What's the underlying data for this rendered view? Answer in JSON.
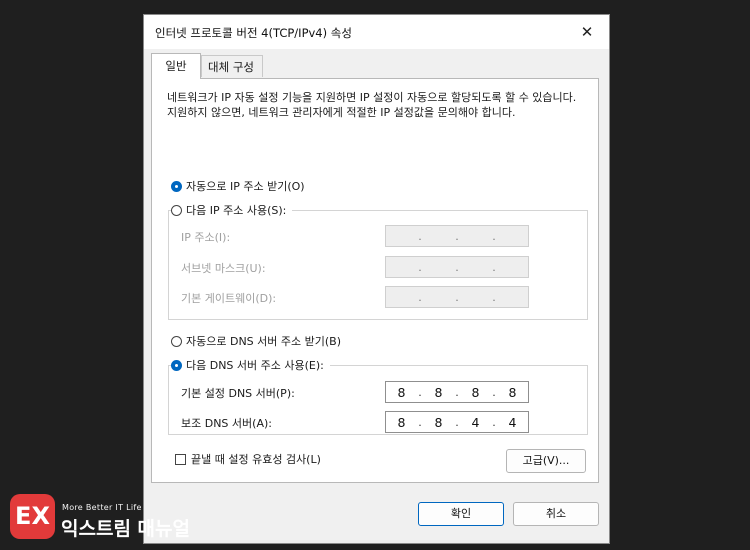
{
  "window": {
    "title": "인터넷 프로토콜 버전 4(TCP/IPv4) 속성",
    "close_glyph": "✕"
  },
  "tabs": [
    {
      "label": "일반"
    },
    {
      "label": "대체 구성"
    }
  ],
  "description": "네트워크가 IP 자동 설정 기능을 지원하면 IP 설정이 자동으로 할당되도록 할 수 있습니다. 지원하지 않으면, 네트워크 관리자에게 적절한 IP 설정값을 문의해야 합니다.",
  "ip_options": {
    "auto_label": "자동으로 IP 주소 받기(O)",
    "manual_label": "다음 IP 주소 사용(S):",
    "selected": "auto"
  },
  "ip_fields": [
    {
      "label": "IP 주소(I):",
      "octets": [
        "",
        "",
        "",
        ""
      ]
    },
    {
      "label": "서브넷 마스크(U):",
      "octets": [
        "",
        "",
        "",
        ""
      ]
    },
    {
      "label": "기본 게이트웨이(D):",
      "octets": [
        "",
        "",
        "",
        ""
      ]
    }
  ],
  "dns_options": {
    "auto_label": "자동으로 DNS 서버 주소 받기(B)",
    "manual_label": "다음 DNS 서버 주소 사용(E):",
    "selected": "manual"
  },
  "dns_fields": [
    {
      "label": "기본 설정 DNS 서버(P):",
      "octets": [
        "8",
        "8",
        "8",
        "8"
      ]
    },
    {
      "label": "보조 DNS 서버(A):",
      "octets": [
        "8",
        "8",
        "4",
        "4"
      ]
    }
  ],
  "validate_checkbox": {
    "label": "끝낼 때 설정 유효성 검사(L)",
    "checked": false
  },
  "buttons": {
    "advanced": "고급(V)...",
    "ok": "확인",
    "cancel": "취소"
  },
  "branding": {
    "logo_text": "EX",
    "tagline": "More Better IT Life",
    "name": "익스트림 매뉴얼",
    "logo_color": "#e23a3a"
  },
  "colors": {
    "accent": "#0067c0"
  }
}
